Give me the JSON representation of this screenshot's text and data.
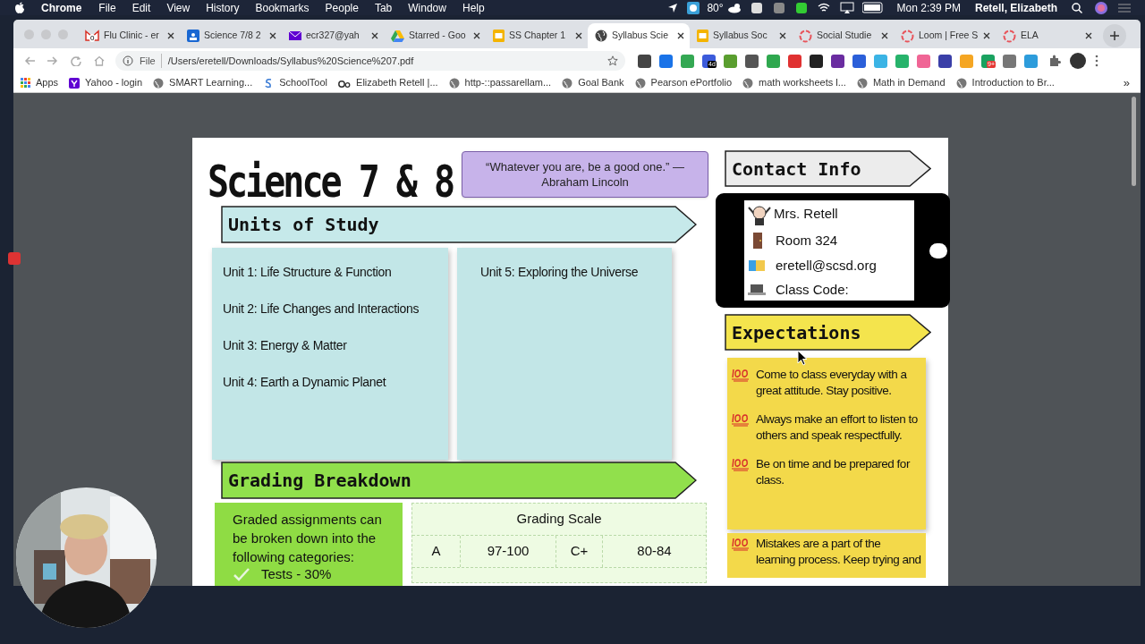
{
  "menu_bar": {
    "app": "Chrome",
    "items": [
      "File",
      "Edit",
      "View",
      "History",
      "Bookmarks",
      "People",
      "Tab",
      "Window",
      "Help"
    ],
    "temperature": "80°",
    "clock": "Mon 2:39 PM",
    "user": "Retell, Elizabeth"
  },
  "tabs": [
    {
      "title": "Flu Clinic - er",
      "selected": false,
      "badge": "0"
    },
    {
      "title": "Science 7/8 2",
      "selected": false
    },
    {
      "title": "ecr327@yah",
      "selected": false
    },
    {
      "title": "Starred - Goo",
      "selected": false
    },
    {
      "title": "SS Chapter 1",
      "selected": false
    },
    {
      "title": "Syllabus Scie",
      "selected": true
    },
    {
      "title": "Syllabus Soc",
      "selected": false
    },
    {
      "title": "Social Studie",
      "selected": false
    },
    {
      "title": "Loom | Free S",
      "selected": false
    },
    {
      "title": "ELA",
      "selected": false
    }
  ],
  "address_bar": {
    "scheme": "File",
    "url": "/Users/eretell/Downloads/Syllabus%20Science%207.pdf"
  },
  "extensions": [
    {
      "color": "#444444"
    },
    {
      "color": "#1a73e8"
    },
    {
      "color": "#34a853"
    },
    {
      "color": "#3b5bdb",
      "badge": "4d"
    },
    {
      "color": "#5a9e2f"
    },
    {
      "color": "#555555"
    },
    {
      "color": "#2fa84f"
    },
    {
      "color": "#e03131"
    },
    {
      "color": "#222222"
    },
    {
      "color": "#6a2ca0"
    },
    {
      "color": "#2b5fd9"
    },
    {
      "color": "#3bb4e5"
    },
    {
      "color": "#27b36b"
    },
    {
      "color": "#f06595"
    },
    {
      "color": "#3a3fa8"
    },
    {
      "color": "#f5a623"
    },
    {
      "color": "#1aa260",
      "badge": "9+"
    },
    {
      "color": "#777777"
    },
    {
      "color": "#2d9cdb"
    }
  ],
  "bookmarks": [
    "Apps",
    "Yahoo - login",
    "SMART Learning...",
    "SchoolTool",
    "Elizabeth Retell |...",
    "http-::passarellam...",
    "Goal Bank",
    "Pearson ePortfolio",
    "math worksheets l...",
    "Math in Demand",
    "Introduction to Br..."
  ],
  "bookmarks_overflow": "»",
  "document": {
    "title": "Science 7 & 8",
    "quote": "“Whatever you are, be a good one.” — Abraham Lincoln",
    "units": {
      "heading": "Units of Study",
      "column_1": [
        "Unit 1: Life Structure & Function",
        "Unit 2: Life Changes and Interactions",
        "Unit 3: Energy & Matter",
        "Unit 4: Earth a Dynamic Planet"
      ],
      "column_2": [
        "Unit 5: Exploring the Universe"
      ]
    },
    "grading": {
      "heading": "Grading Breakdown",
      "note": "Graded assignments can be broken down into the following categories:",
      "categories": [
        "Tests - 30%"
      ],
      "scale_title": "Grading Scale",
      "scale_rows": [
        [
          "A",
          "97-100",
          "C+",
          "80-84"
        ]
      ]
    },
    "contact": {
      "heading": "Contact Info",
      "items": [
        {
          "kind": "avatar",
          "text": "Mrs. Retell"
        },
        {
          "kind": "door",
          "text": "Room 324"
        },
        {
          "kind": "mail",
          "text": "eretell@scsd.org"
        },
        {
          "kind": "laptop",
          "text": "Class Code:"
        }
      ]
    },
    "expectations": {
      "heading": "Expectations",
      "items": [
        "Come to class everyday with a great attitude. Stay positive.",
        "Always make an effort to listen to others and speak respectfully.",
        "Be on time and be prepared for class.",
        "Mistakes are a part of the learning process. Keep trying and"
      ]
    }
  }
}
